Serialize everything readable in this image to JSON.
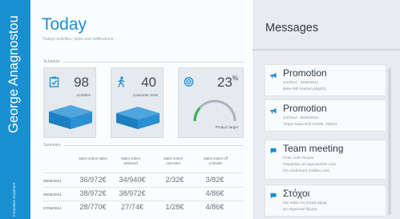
{
  "user": {
    "name": "George Anagnostou",
    "role": "Innovative Anywhere"
  },
  "header": {
    "title": "Today",
    "subtitle": "Todays activities, tasks and notifications"
  },
  "schedule": {
    "label": "Schedule",
    "tiles": [
      {
        "value": "98",
        "label": "Activities",
        "icon": "clipboard-check-icon"
      },
      {
        "value": "40",
        "label": "Customer visits",
        "icon": "walking-person-icon"
      },
      {
        "value": "23",
        "suffix": "%",
        "label": "Product target",
        "icon": "target-icon",
        "gauge": 0.23
      }
    ]
  },
  "summary": {
    "label": "Summary",
    "columns": [
      "Sales orders taken",
      "Sales orders delivered",
      "Sales orders canceled",
      "Sales orders off schedule"
    ],
    "rows": [
      {
        "date": "05/06/2014",
        "values": [
          "36/972€",
          "34/940€",
          "2/32€",
          "3/82€"
        ]
      },
      {
        "date": "06/06/2014",
        "values": [
          "38/972€",
          "38/972€",
          "",
          "4/86€"
        ]
      },
      {
        "date": "07/06/2014",
        "values": [
          "28/770€",
          "27/74€",
          "1/28€",
          "4/86€"
        ]
      }
    ]
  },
  "messages": {
    "title": "Messages",
    "items": [
      {
        "icon": "megaphone-icon",
        "title": "Promotion",
        "lines": [
          "1/1/2014 - 30/06/2014",
          "Bake Roll Κλασική 80gr(G)"
        ]
      },
      {
        "icon": "megaphone-icon",
        "title": "Promotion",
        "lines": [
          "1/1/2014 - 30/06/2014",
          "7Days Swiss Roll 175GR, 7SEM1"
        ]
      },
      {
        "icon": "chat-bubble-icon",
        "title": "Team meeting",
        "lines": [
          "From: John Πετρέα",
          "Παρακαλώ να παρευρεθείτε στην",
          "στη συνάντηση σταξάνω στις"
        ]
      },
      {
        "icon": "chat-bubble-icon",
        "title": "Στόχοι",
        "lines": [
          "Σας καλώ στη λογική φήμης",
          "για σημαντικά θέματα"
        ]
      }
    ]
  },
  "colors": {
    "accent": "#1a8fd0",
    "panel": "#e8ecf0",
    "tile": "#e5eaef"
  }
}
